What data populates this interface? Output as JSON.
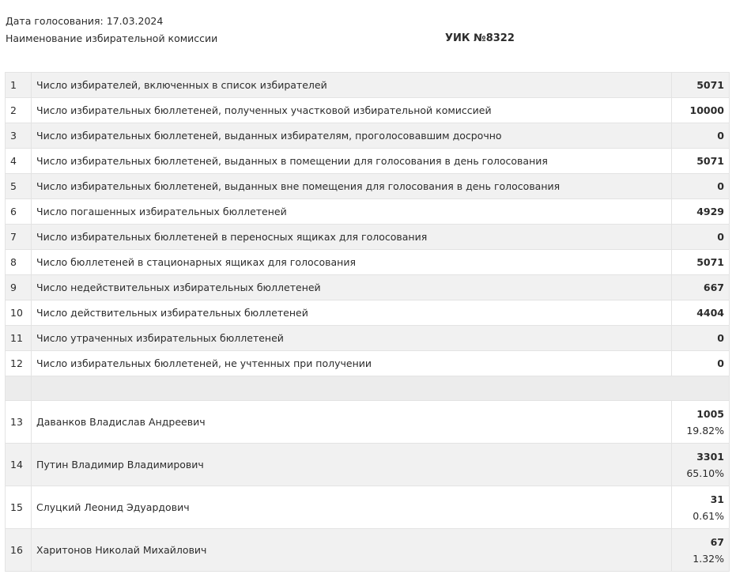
{
  "header": {
    "date_label": "Дата голосования:",
    "date_value": "17.03.2024",
    "commission_label": "Наименование избирательной комиссии",
    "commission_name": "УИК №8322"
  },
  "protocol_lines": [
    {
      "num": "1",
      "label": "Число избирателей, включенных в список избирателей",
      "value": "5071"
    },
    {
      "num": "2",
      "label": "Число избирательных бюллетеней, полученных участковой избирательной комиссией",
      "value": "10000"
    },
    {
      "num": "3",
      "label": "Число избирательных бюллетеней, выданных избирателям, проголосовавшим досрочно",
      "value": "0"
    },
    {
      "num": "4",
      "label": "Число избирательных бюллетеней, выданных в помещении для голосования в день голосования",
      "value": "5071"
    },
    {
      "num": "5",
      "label": "Число избирательных бюллетеней, выданных вне помещения для голосования в день голосования",
      "value": "0"
    },
    {
      "num": "6",
      "label": "Число погашенных избирательных бюллетеней",
      "value": "4929"
    },
    {
      "num": "7",
      "label": "Число избирательных бюллетеней в переносных ящиках для голосования",
      "value": "0"
    },
    {
      "num": "8",
      "label": "Число бюллетеней в стационарных ящиках для голосования",
      "value": "5071"
    },
    {
      "num": "9",
      "label": "Число недействительных избирательных бюллетеней",
      "value": "667"
    },
    {
      "num": "10",
      "label": "Число действительных избирательных бюллетеней",
      "value": "4404"
    },
    {
      "num": "11",
      "label": "Число утраченных избирательных бюллетеней",
      "value": "0"
    },
    {
      "num": "12",
      "label": "Число избирательных бюллетеней, не учтенных при получении",
      "value": "0"
    }
  ],
  "candidates": [
    {
      "num": "13",
      "name": "Даванков Владислав Андреевич",
      "votes": "1005",
      "percent": "19.82%"
    },
    {
      "num": "14",
      "name": "Путин Владимир Владимирович",
      "votes": "3301",
      "percent": "65.10%"
    },
    {
      "num": "15",
      "name": "Слуцкий Леонид Эдуардович",
      "votes": "31",
      "percent": "0.61%"
    },
    {
      "num": "16",
      "name": "Харитонов Николай Михайлович",
      "votes": "67",
      "percent": "1.32%"
    }
  ]
}
